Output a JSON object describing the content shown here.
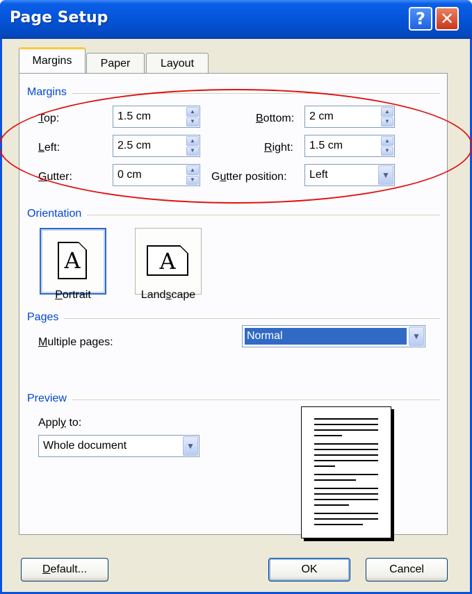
{
  "window": {
    "title": "Page Setup",
    "help_glyph": "?",
    "close_glyph": "✕"
  },
  "tabs": [
    {
      "label": "Margins",
      "active": true
    },
    {
      "label": "Paper",
      "active": false
    },
    {
      "label": "Layout",
      "active": false
    }
  ],
  "margins": {
    "group_label": "Margins",
    "top": {
      "label_first": "T",
      "label_rest": "op:",
      "value": "1.5 cm"
    },
    "left": {
      "label_first": "L",
      "label_rest": "eft:",
      "value": "2.5 cm"
    },
    "gutter": {
      "label_first": "G",
      "label_rest": "utter:",
      "value": "0 cm"
    },
    "bottom": {
      "label_first": "B",
      "label_rest": "ottom:",
      "value": "2 cm"
    },
    "right": {
      "label_first": "R",
      "label_rest": "ight:",
      "value": "1.5 cm"
    },
    "gutter_position": {
      "label_pre": "G",
      "label_u": "u",
      "label_rest": "tter position:",
      "value": "Left"
    }
  },
  "orientation": {
    "group_label": "Orientation",
    "portrait": {
      "label_first": "P",
      "label_rest": "ortrait",
      "glyph": "A",
      "selected": true
    },
    "landscape": {
      "label_pre": "Land",
      "label_u": "s",
      "label_rest": "cape",
      "glyph": "A",
      "selected": false
    }
  },
  "pages": {
    "group_label": "Pages",
    "multiple_label_first": "M",
    "multiple_label_rest": "ultiple pages:",
    "multiple_value": "Normal"
  },
  "preview": {
    "group_label": "Preview",
    "apply_label_pre": "Appl",
    "apply_label_u": "y",
    "apply_label_rest": " to:",
    "apply_value": "Whole document"
  },
  "buttons": {
    "default_first": "D",
    "default_rest": "efault...",
    "ok": "OK",
    "cancel": "Cancel"
  },
  "colors": {
    "titlebar": "#0454d8",
    "group_label": "#0046d5",
    "annotation": "#e01010",
    "selection": "#316ac5"
  }
}
